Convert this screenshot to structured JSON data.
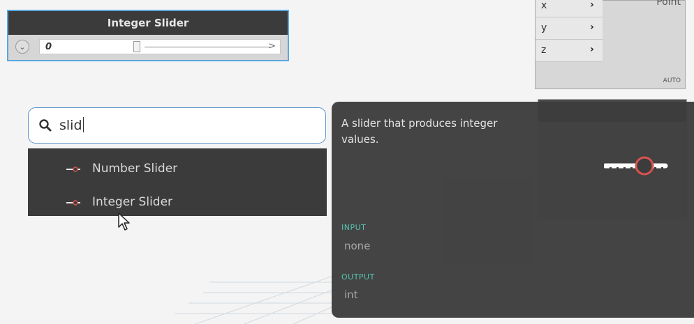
{
  "slider_node": {
    "title": "Integer Slider",
    "value": "0",
    "expand_label": ">"
  },
  "point_node": {
    "output_label": "Point",
    "ports": [
      "x",
      "y",
      "z"
    ],
    "lacing": "AUTO"
  },
  "search": {
    "query": "slid"
  },
  "results": [
    {
      "label": "Number Slider"
    },
    {
      "label": "Integer Slider"
    }
  ],
  "tooltip": {
    "description": "A slider that produces integer values.",
    "input_label": "INPUT",
    "input_value": "none",
    "output_label": "OUTPUT",
    "output_value": "int"
  },
  "colors": {
    "accent": "#5aa6df",
    "section_label": "#57c2b1",
    "tooltip_bg": "#3c3c3c",
    "slider_icon_red": "#d9534f"
  }
}
